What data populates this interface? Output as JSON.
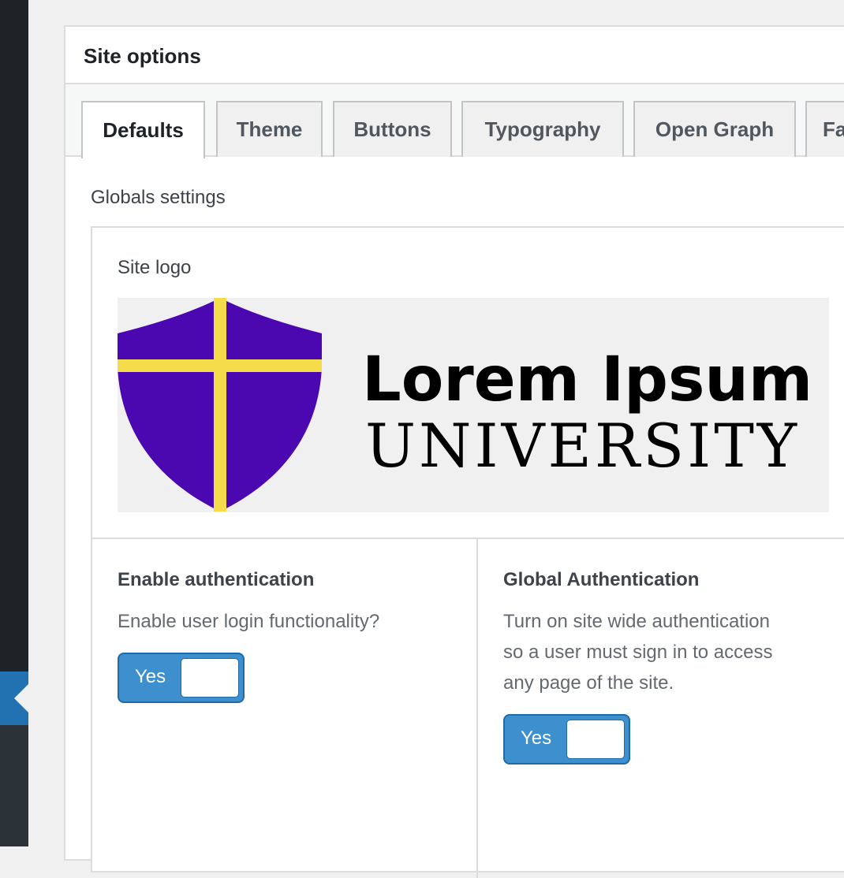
{
  "panel": {
    "title": "Site options"
  },
  "tabs": [
    {
      "label": "Defaults",
      "active": true
    },
    {
      "label": "Theme",
      "active": false
    },
    {
      "label": "Buttons",
      "active": false
    },
    {
      "label": "Typography",
      "active": false
    },
    {
      "label": "Open Graph",
      "active": false
    },
    {
      "label": "Fa",
      "active": false
    }
  ],
  "globals": {
    "section_title": "Globals settings",
    "site_logo": {
      "label": "Site logo",
      "logo_line1": "Lorem Ipsum",
      "logo_line2": "UNIVERSITY",
      "shield_color": "#4b08b0",
      "cross_color": "#f5dc4a"
    },
    "enable_auth": {
      "label": "Enable authentication",
      "description": "Enable user login functionality?",
      "toggle_label": "Yes"
    },
    "global_auth": {
      "label": "Global Authentication",
      "description_lines": [
        "Turn on site wide authentication",
        "so a user must sign in to access",
        "any page of the site."
      ],
      "toggle_label": "Yes"
    }
  },
  "colors": {
    "admin_sidebar": "#1d2327",
    "admin_highlight": "#2271b1",
    "toggle_on": "#3d8fce"
  }
}
